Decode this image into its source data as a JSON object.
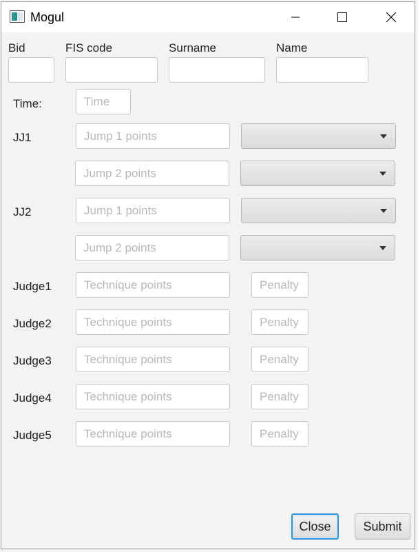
{
  "window": {
    "title": "Mogul"
  },
  "header_fields": {
    "bid_label": "Bid",
    "fis_label": "FIS code",
    "surname_label": "Surname",
    "name_label": "Name"
  },
  "time": {
    "label": "Time:",
    "placeholder": "Time"
  },
  "jj1": {
    "label": "JJ1",
    "jump1_placeholder": "Jump 1 points",
    "jump2_placeholder": "Jump 2 points"
  },
  "jj2": {
    "label": "JJ2",
    "jump1_placeholder": "Jump 1 points",
    "jump2_placeholder": "Jump 2 points"
  },
  "judges": [
    {
      "label": "Judge1",
      "technique_placeholder": "Technique points",
      "penalty_placeholder": "Penalty"
    },
    {
      "label": "Judge2",
      "technique_placeholder": "Technique points",
      "penalty_placeholder": "Penalty"
    },
    {
      "label": "Judge3",
      "technique_placeholder": "Technique points",
      "penalty_placeholder": "Penalty"
    },
    {
      "label": "Judge4",
      "technique_placeholder": "Technique points",
      "penalty_placeholder": "Penalty"
    },
    {
      "label": "Judge5",
      "technique_placeholder": "Technique points",
      "penalty_placeholder": "Penalty"
    }
  ],
  "buttons": {
    "close_label": "Close",
    "submit_label": "Submit"
  },
  "icons": {
    "app": "app-window-icon",
    "minimize": "minimize-icon",
    "maximize": "maximize-icon",
    "close": "close-icon",
    "dropdown": "chevron-down-icon"
  },
  "colors": {
    "focus_accent": "#2f95e0",
    "window_bg": "#f3f3f3",
    "titlebar_bg": "#ffffff"
  }
}
